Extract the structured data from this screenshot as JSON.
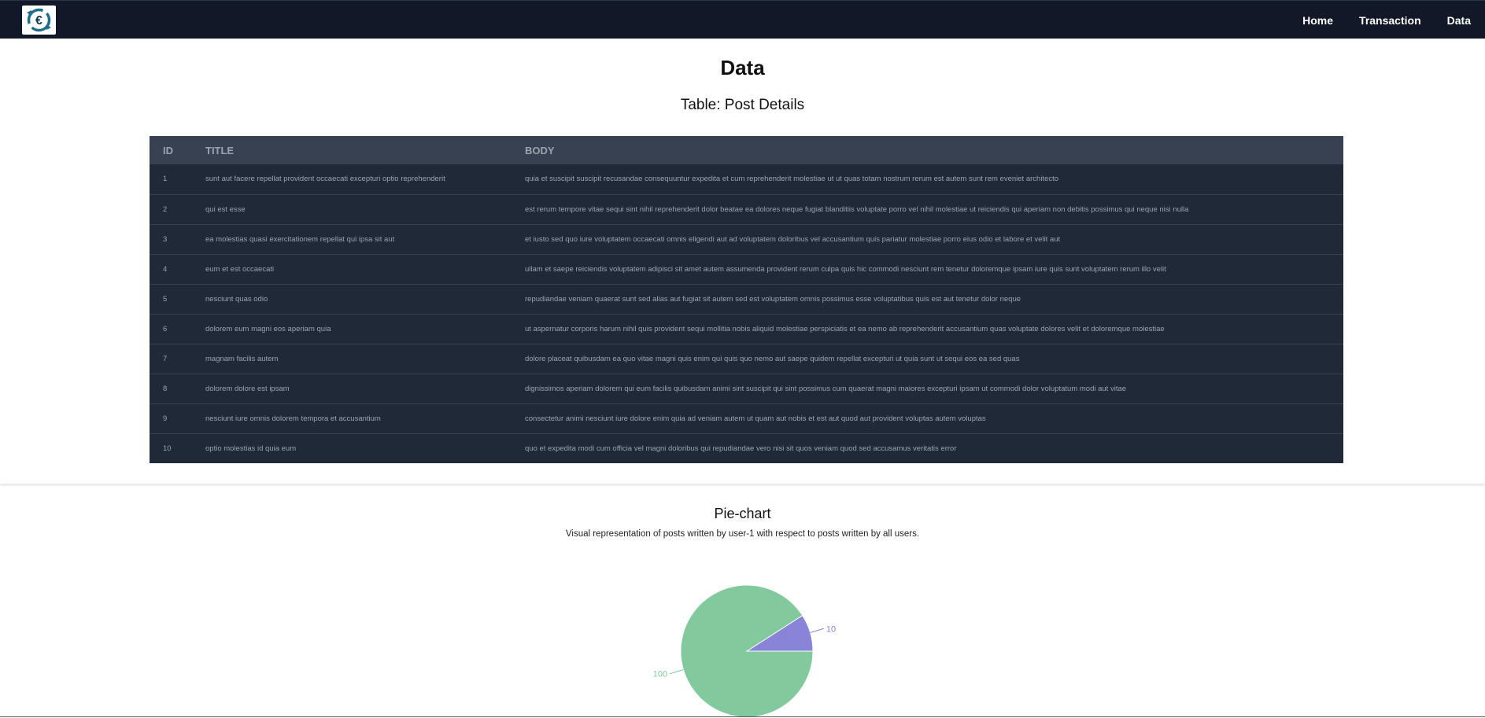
{
  "nav": {
    "logo_alt": "currency exchange logo",
    "links": [
      "Home",
      "Transaction",
      "Data"
    ]
  },
  "page": {
    "title": "Data",
    "table_caption": "Table: Post Details"
  },
  "table": {
    "headers": [
      "ID",
      "TITLE",
      "BODY"
    ],
    "rows": [
      {
        "id": "1",
        "title": "sunt aut facere repellat provident occaecati excepturi optio reprehenderit",
        "body": "quia et suscipit suscipit recusandae consequuntur expedita et cum reprehenderit molestiae ut ut quas totam nostrum rerum est autem sunt rem eveniet architecto"
      },
      {
        "id": "2",
        "title": "qui est esse",
        "body": "est rerum tempore vitae sequi sint nihil reprehenderit dolor beatae ea dolores neque fugiat blanditiis voluptate porro vel nihil molestiae ut reiciendis qui aperiam non debitis possimus qui neque nisi nulla"
      },
      {
        "id": "3",
        "title": "ea molestias quasi exercitationem repellat qui ipsa sit aut",
        "body": "et iusto sed quo iure voluptatem occaecati omnis eligendi aut ad voluptatem doloribus vel accusantium quis pariatur molestiae porro eius odio et labore et velit aut"
      },
      {
        "id": "4",
        "title": "eum et est occaecati",
        "body": "ullam et saepe reiciendis voluptatem adipisci sit amet autem assumenda provident rerum culpa quis hic commodi nesciunt rem tenetur doloremque ipsam iure quis sunt voluptatem rerum illo velit"
      },
      {
        "id": "5",
        "title": "nesciunt quas odio",
        "body": "repudiandae veniam quaerat sunt sed alias aut fugiat sit autem sed est voluptatem omnis possimus esse voluptatibus quis est aut tenetur dolor neque"
      },
      {
        "id": "6",
        "title": "dolorem eum magni eos aperiam quia",
        "body": "ut aspernatur corporis harum nihil quis provident sequi mollitia nobis aliquid molestiae perspiciatis et ea nemo ab reprehenderit accusantium quas voluptate dolores velit et doloremque molestiae"
      },
      {
        "id": "7",
        "title": "magnam facilis autem",
        "body": "dolore placeat quibusdam ea quo vitae magni quis enim qui quis quo nemo aut saepe quidem repellat excepturi ut quia sunt ut sequi eos ea sed quas"
      },
      {
        "id": "8",
        "title": "dolorem dolore est ipsam",
        "body": "dignissimos aperiam dolorem qui eum facilis quibusdam animi sint suscipit qui sint possimus cum quaerat magni maiores excepturi ipsam ut commodi dolor voluptatum modi aut vitae"
      },
      {
        "id": "9",
        "title": "nesciunt iure omnis dolorem tempora et accusantium",
        "body": "consectetur animi nesciunt iure dolore enim quia ad veniam autem ut quam aut nobis et est aut quod aut provident voluptas autem voluptas"
      },
      {
        "id": "10",
        "title": "optio molestias id quia eum",
        "body": "quo et expedita modi cum officia vel magni doloribus qui repudiandae vero nisi sit quos veniam quod sed accusamus veritatis error"
      }
    ]
  },
  "pie_section": {
    "title": "Pie-chart",
    "description": "Visual representation of posts written by user-1 with respect to posts written by all users."
  },
  "chart_data": {
    "type": "pie",
    "title": "",
    "values": [
      10,
      100
    ],
    "labels": [
      "10",
      "100"
    ],
    "colors": [
      "#8884d8",
      "#82ca9d"
    ],
    "label_colors": [
      "#8884d8",
      "#82ca9d"
    ]
  }
}
